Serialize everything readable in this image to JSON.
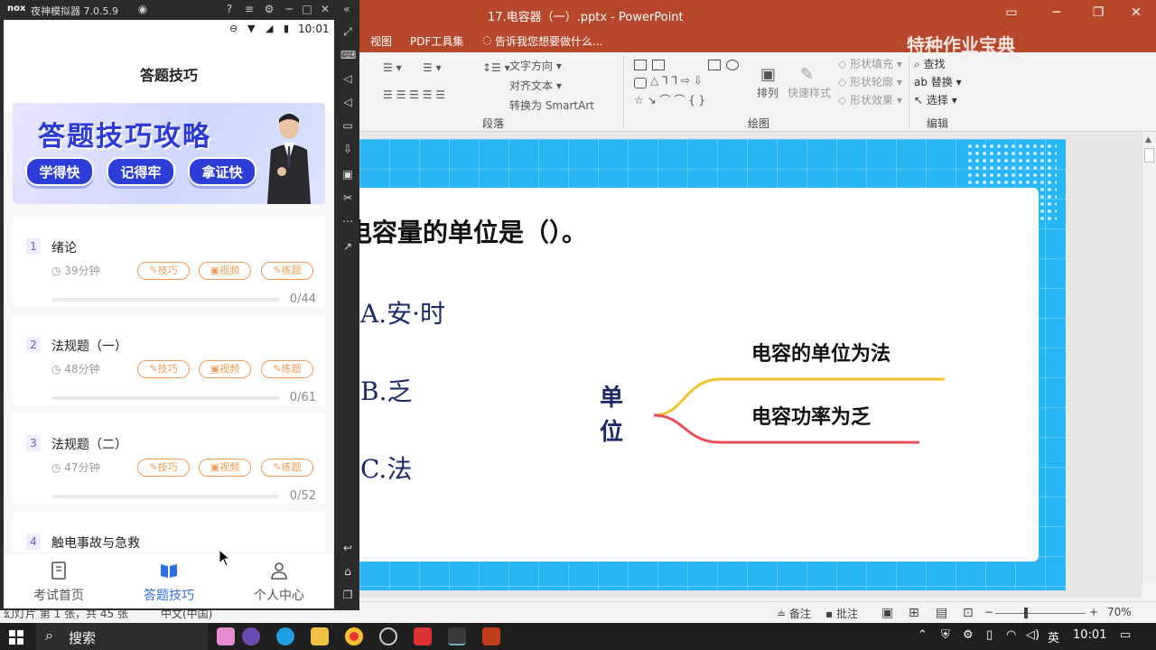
{
  "ppt": {
    "title": "17.电容器（一）.pptx - PowerPoint",
    "menu": [
      "视图",
      "PDF工具集"
    ],
    "tell_me": "告诉我您想要做什么...",
    "brand": "特种作业宝典",
    "ribbon": {
      "text_direction": "文字方向",
      "align_text": "对齐文本",
      "convert_smartart": "转换为 SmartArt",
      "paragraph_group": "段落",
      "arrange": "排列",
      "quick_styles": "快速样式",
      "shape_fill": "形状填充",
      "shape_outline": "形状轮廓",
      "shape_effects": "形状效果",
      "drawing_group": "绘图",
      "find": "查找",
      "replace": "替换",
      "select": "选择",
      "editing_group": "编辑"
    },
    "slide": {
      "question": "电容量的单位是（）。",
      "options": [
        "A.安·时",
        "B.乏",
        "C.法"
      ],
      "mind_root": "单位",
      "branches": [
        "电容的单位为法",
        "电容功率为乏"
      ],
      "colors": {
        "branch_top": "#f2c12e",
        "branch_bottom": "#e8505b",
        "slide_bg": "#29b6f6"
      }
    },
    "status": {
      "slide_info": "幻灯片 第 1 张，共 45 张",
      "language": "中文(中国)",
      "notes": "备注",
      "comments": "批注",
      "zoom": "70%"
    }
  },
  "nox": {
    "logo": "nox",
    "version": "夜神模拟器 7.0.5.9"
  },
  "phone": {
    "time": "10:01",
    "title": "答题技巧",
    "banner": {
      "title": "答题技巧攻略",
      "pills": [
        "学得快",
        "记得牢",
        "拿证快"
      ]
    },
    "courses": [
      {
        "num": "1",
        "title": "绪论",
        "duration": "39分钟",
        "tags": [
          "技巧",
          "视频",
          "练题"
        ],
        "progress": "0/44"
      },
      {
        "num": "2",
        "title": "法规题（一）",
        "duration": "48分钟",
        "tags": [
          "技巧",
          "视频",
          "练题"
        ],
        "progress": "0/61"
      },
      {
        "num": "3",
        "title": "法规题（二）",
        "duration": "47分钟",
        "tags": [
          "技巧",
          "视频",
          "练题"
        ],
        "progress": "0/52"
      },
      {
        "num": "4",
        "title": "触电事故与急救",
        "duration": "",
        "tags": [],
        "progress": ""
      }
    ],
    "nav": [
      {
        "label": "考试首页",
        "active": false
      },
      {
        "label": "答题技巧",
        "active": true
      },
      {
        "label": "个人中心",
        "active": false
      }
    ],
    "accent": "#2f6fe0",
    "tag_color": "#f19a55"
  },
  "taskbar": {
    "search": "搜索",
    "ime": "英",
    "clock": "10:01"
  }
}
